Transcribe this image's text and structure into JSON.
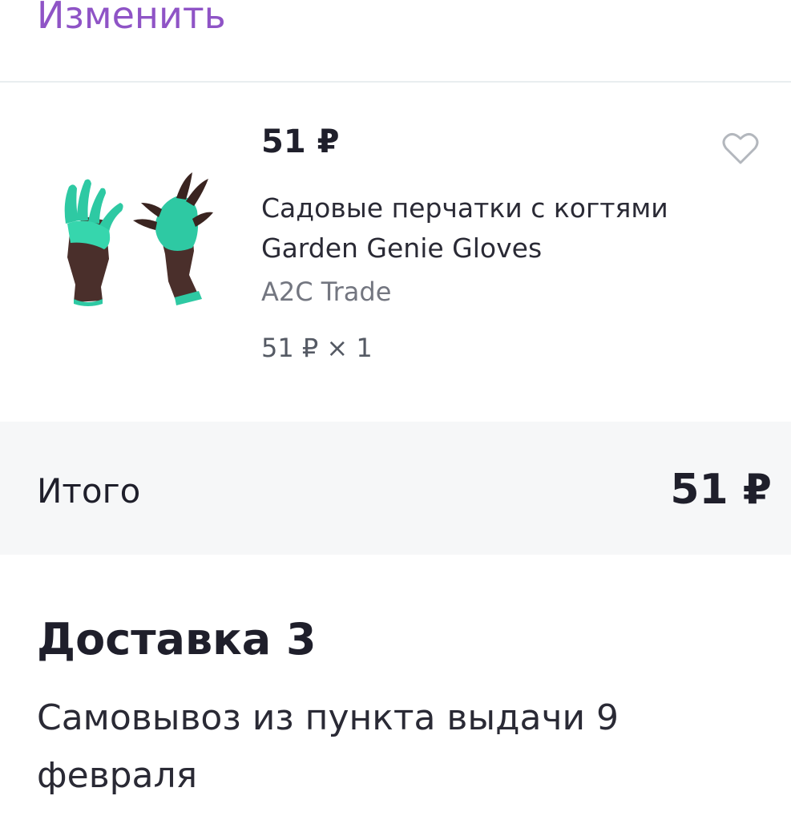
{
  "header": {
    "edit_label": "Изменить"
  },
  "product": {
    "price": "51 ₽",
    "title": "Садовые перчатки с когтями Garden Genie Gloves",
    "seller": "A2C Trade",
    "unit_price_line": "51 ₽ × 1",
    "favorite_icon": "heart-outline-icon",
    "image": "garden-gloves-with-claws"
  },
  "summary": {
    "total_label": "Итого",
    "total_value": "51 ₽"
  },
  "delivery": {
    "title": "Доставка 3",
    "description": "Самовывоз из пункта выдачи 9 февраля"
  },
  "colors": {
    "accent": "#8f54c6",
    "glove_green": "#2ec9a3",
    "glove_brown": "#4a2f2b",
    "total_bg": "#f6f7f8"
  }
}
